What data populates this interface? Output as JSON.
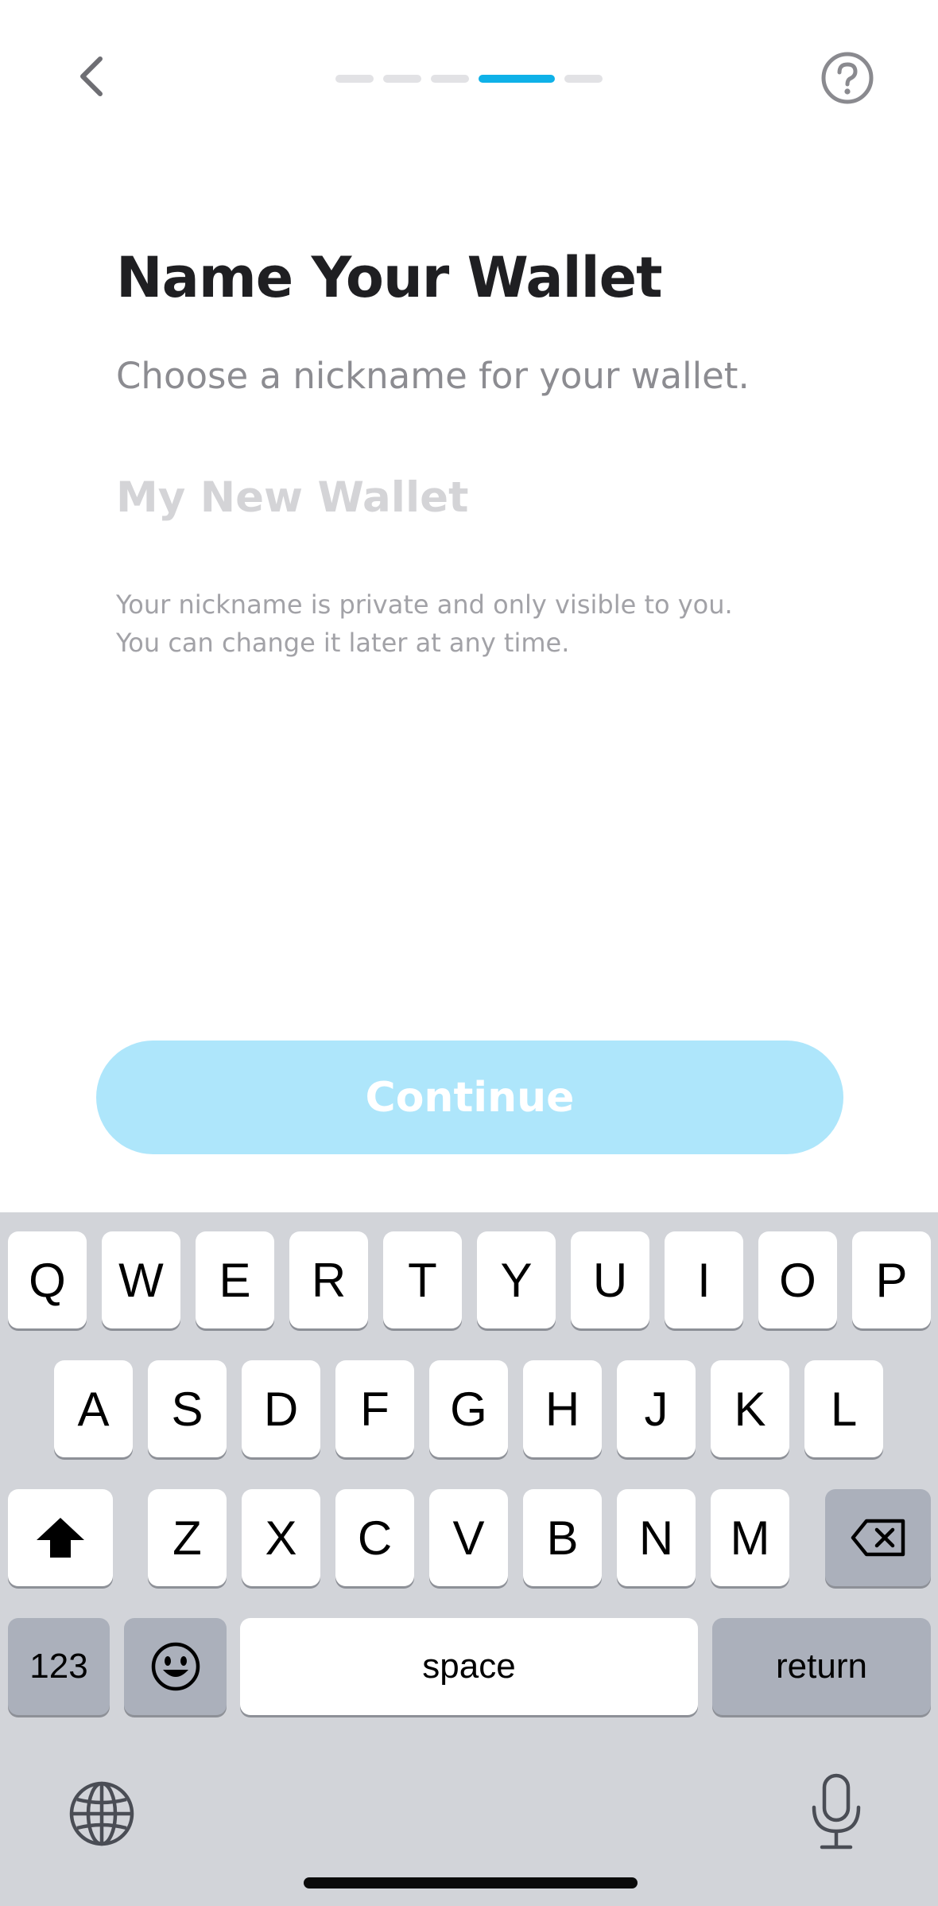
{
  "header": {
    "back_icon": "chevron-left-icon",
    "help_icon": "question-circle-icon",
    "progress": {
      "total_steps": 5,
      "current_step": 4
    }
  },
  "content": {
    "title": "Name Your Wallet",
    "subtitle": "Choose a nickname for your wallet.",
    "input": {
      "value": "",
      "placeholder": "My New Wallet"
    },
    "hint_line1": "Your nickname is private and only visible to you.",
    "hint_line2": "You can change it later at any time."
  },
  "continue_button": {
    "label": "Continue"
  },
  "colors": {
    "accent": "#0fb1e8",
    "button_disabled": "#aee6fb",
    "title": "#1f1f22",
    "subtitle": "#8c8c91",
    "keyboard_bg": "#d2d4d9"
  },
  "keyboard": {
    "row1": [
      "Q",
      "W",
      "E",
      "R",
      "T",
      "Y",
      "U",
      "I",
      "O",
      "P"
    ],
    "row2": [
      "A",
      "S",
      "D",
      "F",
      "G",
      "H",
      "J",
      "K",
      "L"
    ],
    "row3": [
      "Z",
      "X",
      "C",
      "V",
      "B",
      "N",
      "M"
    ],
    "shift_icon": "shift-arrow-icon",
    "delete_icon": "backspace-icon",
    "numbers_label": "123",
    "emoji_icon": "emoji-icon",
    "space_label": "space",
    "return_label": "return",
    "globe_icon": "globe-icon",
    "mic_icon": "microphone-icon"
  }
}
